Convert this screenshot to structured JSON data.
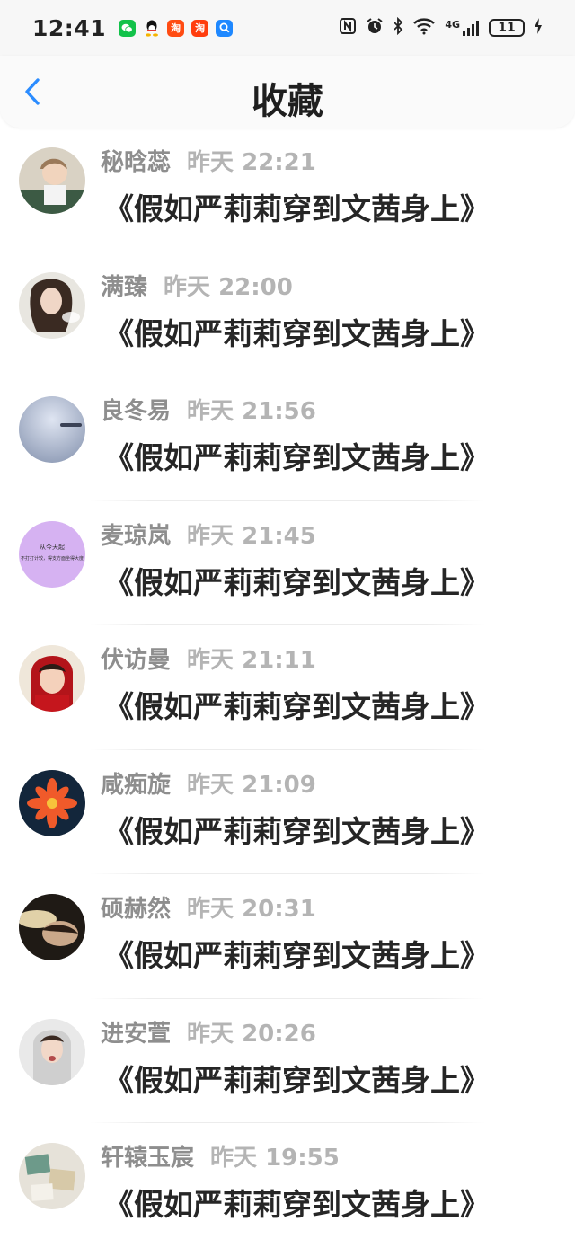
{
  "status_bar": {
    "time": "12:41",
    "notifications": [
      {
        "icon": "wechat-icon",
        "glyph": "◙"
      },
      {
        "icon": "qq-icon",
        "glyph": "🐧"
      },
      {
        "icon": "taobao-icon",
        "glyph": "淘"
      },
      {
        "icon": "taobao-icon",
        "glyph": "淘"
      },
      {
        "icon": "search-app-icon",
        "glyph": "Q"
      }
    ],
    "network": "4G",
    "battery": "11"
  },
  "header": {
    "title": "收藏",
    "back_icon": "chevron-left-icon"
  },
  "colors": {
    "accent": "#2b8cff",
    "name_gray": "#8e8e8e",
    "time_gray": "#b4b4b4"
  },
  "favorites": [
    {
      "name": "秘晗蕊",
      "time": "昨天 22:21",
      "message": "《假如严莉莉穿到文茜身上》"
    },
    {
      "name": "满臻",
      "time": "昨天 22:00",
      "message": "《假如严莉莉穿到文茜身上》"
    },
    {
      "name": "良冬易",
      "time": "昨天 21:56",
      "message": "《假如严莉莉穿到文茜身上》"
    },
    {
      "name": "麦琼岚",
      "time": "昨天 21:45",
      "message": "《假如严莉莉穿到文茜身上》",
      "avatar_text": [
        "从今天起",
        "不打打计较，得支方面坐得大度"
      ]
    },
    {
      "name": "伏访曼",
      "time": "昨天 21:11",
      "message": "《假如严莉莉穿到文茜身上》"
    },
    {
      "name": "咸痴旋",
      "time": "昨天 21:09",
      "message": "《假如严莉莉穿到文茜身上》"
    },
    {
      "name": "硕赫然",
      "time": "昨天 20:31",
      "message": "《假如严莉莉穿到文茜身上》"
    },
    {
      "name": "进安萱",
      "time": "昨天 20:26",
      "message": "《假如严莉莉穿到文茜身上》"
    },
    {
      "name": "轩辕玉宸",
      "time": "昨天 19:55",
      "message": "《假如严莉莉穿到文茜身上》"
    }
  ]
}
